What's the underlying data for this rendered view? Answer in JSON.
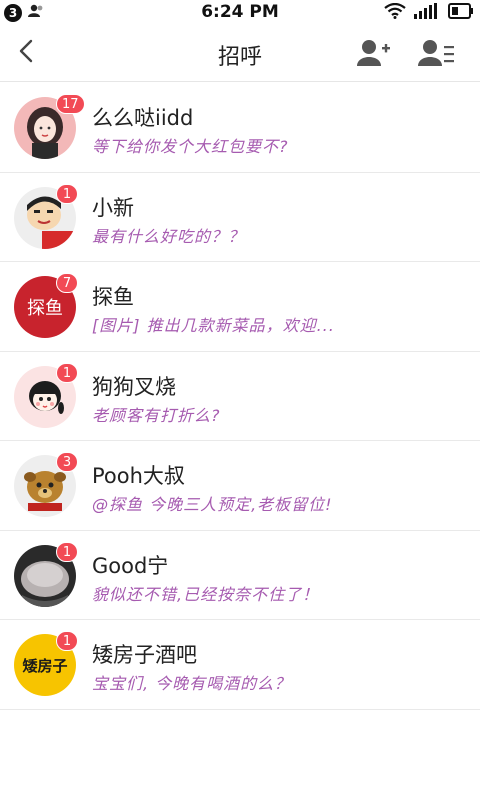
{
  "status_bar": {
    "notification_count": "3",
    "time": "6:24 PM"
  },
  "header": {
    "title": "招呼"
  },
  "colors": {
    "badge": "#f24a55",
    "preview_text": "#a65bb0"
  },
  "chats": [
    {
      "name": "么么哒iidd",
      "preview": "等下给你发个大红包要不?",
      "unread": "17",
      "avatar_icon": "girl-avatar-icon"
    },
    {
      "name": "小新",
      "preview": "最有什么好吃的？？",
      "unread": "1",
      "avatar_icon": "crayon-shin-avatar-icon"
    },
    {
      "name": "探鱼",
      "preview": "[图片] 推出几款新菜品，欢迎...",
      "unread": "7",
      "avatar_icon": "tanyu-logo-icon",
      "avatar_text": "探鱼"
    },
    {
      "name": "狗狗叉烧",
      "preview": "老顾客有打折么?",
      "unread": "1",
      "avatar_icon": "cartoon-girl-avatar-icon"
    },
    {
      "name": "Pooh大叔",
      "preview": "@探鱼 今晚三人预定,老板留位!",
      "unread": "3",
      "avatar_icon": "dog-avatar-icon"
    },
    {
      "name": "Good宁",
      "preview": "貌似还不错,已经按奈不住了！",
      "unread": "1",
      "avatar_icon": "cat-avatar-icon"
    },
    {
      "name": "矮房子酒吧",
      "preview": "宝宝们, 今晚有喝酒的么？",
      "unread": "1",
      "avatar_icon": "bar-logo-icon",
      "avatar_text": "矮房子"
    }
  ]
}
